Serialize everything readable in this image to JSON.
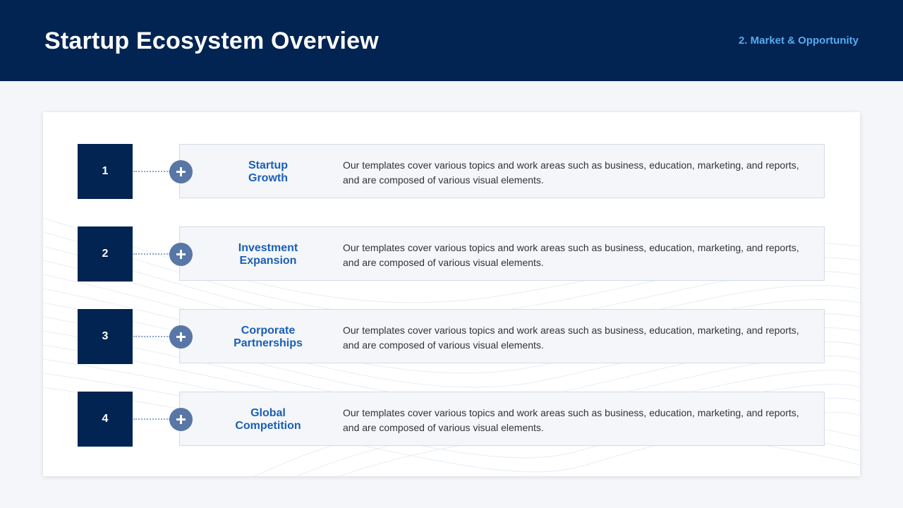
{
  "header": {
    "title": "Startup Ecosystem Overview",
    "section": "2. Market & Opportunity"
  },
  "colors": {
    "header_bg": "#012452",
    "number_box": "#012452",
    "plus_circle": "#5877a6",
    "item_title": "#1a5fb5",
    "section_label": "#5aaaf0"
  },
  "items": [
    {
      "number": "1",
      "title_line1": "Startup",
      "title_line2": "Growth",
      "icon": "plus-icon",
      "description": "Our templates cover various topics and work areas such as business, education, marketing, and reports, and are composed of various visual elements."
    },
    {
      "number": "2",
      "title_line1": "Investment",
      "title_line2": "Expansion",
      "icon": "plus-icon",
      "description": "Our templates cover various topics and work areas such as business, education, marketing, and reports, and are composed of various visual elements."
    },
    {
      "number": "3",
      "title_line1": "Corporate",
      "title_line2": "Partnerships",
      "icon": "plus-icon",
      "description": "Our templates cover various topics and work areas such as business, education, marketing, and reports, and are composed of various visual elements."
    },
    {
      "number": "4",
      "title_line1": "Global",
      "title_line2": "Competition",
      "icon": "plus-icon",
      "description": "Our templates cover various topics and work areas such as business, education, marketing, and reports, and are composed of various visual elements."
    }
  ]
}
